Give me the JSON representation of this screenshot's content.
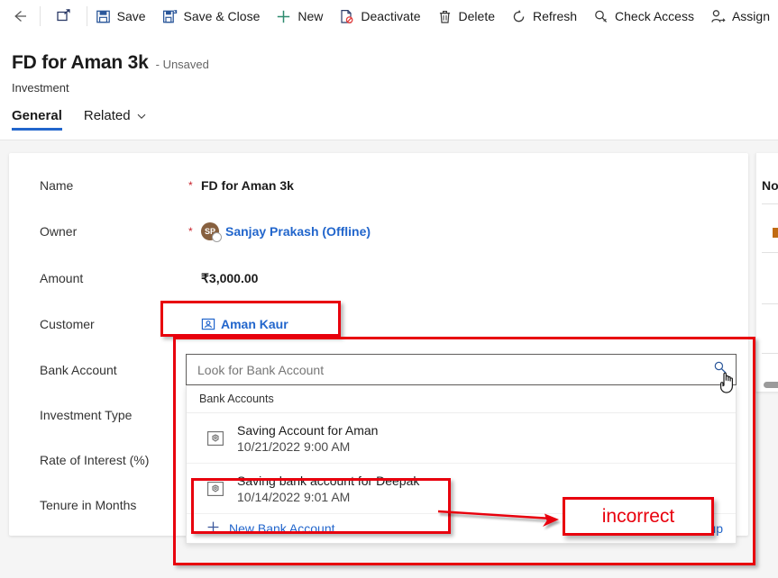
{
  "commandbar": {
    "back_label": "Back",
    "popout_label": "Open in new window",
    "buttons": [
      {
        "label": "Save",
        "icon": "save-icon"
      },
      {
        "label": "Save & Close",
        "icon": "save-and-close-icon"
      },
      {
        "label": "New",
        "icon": "plus-icon"
      },
      {
        "label": "Deactivate",
        "icon": "deactivate-icon"
      },
      {
        "label": "Delete",
        "icon": "trash-icon"
      },
      {
        "label": "Refresh",
        "icon": "refresh-icon"
      },
      {
        "label": "Check Access",
        "icon": "key-icon"
      },
      {
        "label": "Assign",
        "icon": "assign-person-icon"
      }
    ]
  },
  "record": {
    "title": "FD for Aman 3k",
    "state": "- Unsaved",
    "entity": "Investment",
    "tabs": [
      {
        "label": "General",
        "active": true,
        "has_chevron": false
      },
      {
        "label": "Related",
        "active": false,
        "has_chevron": true
      }
    ]
  },
  "form": {
    "fields": [
      {
        "label": "Name",
        "required": true,
        "value": "FD for Aman 3k",
        "kind": "text"
      },
      {
        "label": "Owner",
        "required": true,
        "value": "Sanjay Prakash (Offline)",
        "kind": "user",
        "initials": "SP"
      },
      {
        "label": "Amount",
        "required": false,
        "value": "₹3,000.00",
        "kind": "text"
      },
      {
        "label": "Customer",
        "required": false,
        "value": "Aman Kaur",
        "kind": "lookup"
      },
      {
        "label": "Bank Account",
        "required": false,
        "value": "",
        "kind": "lookup-open"
      },
      {
        "label": "Investment Type",
        "required": false,
        "value": "",
        "kind": "text"
      },
      {
        "label": "Rate of Interest (%)",
        "required": false,
        "value": "",
        "kind": "text"
      },
      {
        "label": "Tenure in Months",
        "required": false,
        "value": "",
        "kind": "text"
      }
    ]
  },
  "lookup": {
    "placeholder": "Look for Bank Account",
    "search_icon": "magnifier-icon",
    "group_header": "Bank Accounts",
    "results": [
      {
        "title": "Saving Account for Aman",
        "subtitle": "10/21/2022 9:00 AM",
        "icon": "record-icon",
        "highlighted": false
      },
      {
        "title": "Saving bank account for Deepak",
        "subtitle": "10/14/2022 9:01 AM",
        "icon": "record-icon",
        "highlighted": true
      }
    ],
    "new_label": "New Bank Account",
    "new_icon": "plus-icon",
    "advanced_label": "Advanced lookup"
  },
  "peek_panel": {
    "title": "No"
  },
  "annotations": {
    "accent_color": "#e8000d",
    "callout_text": "incorrect",
    "boxes": [
      {
        "name": "customer-value-highlight"
      },
      {
        "name": "lookup-dropdown-highlight"
      },
      {
        "name": "deepak-result-highlight"
      }
    ]
  },
  "cursor": {
    "type": "pointing-hand-cursor"
  }
}
